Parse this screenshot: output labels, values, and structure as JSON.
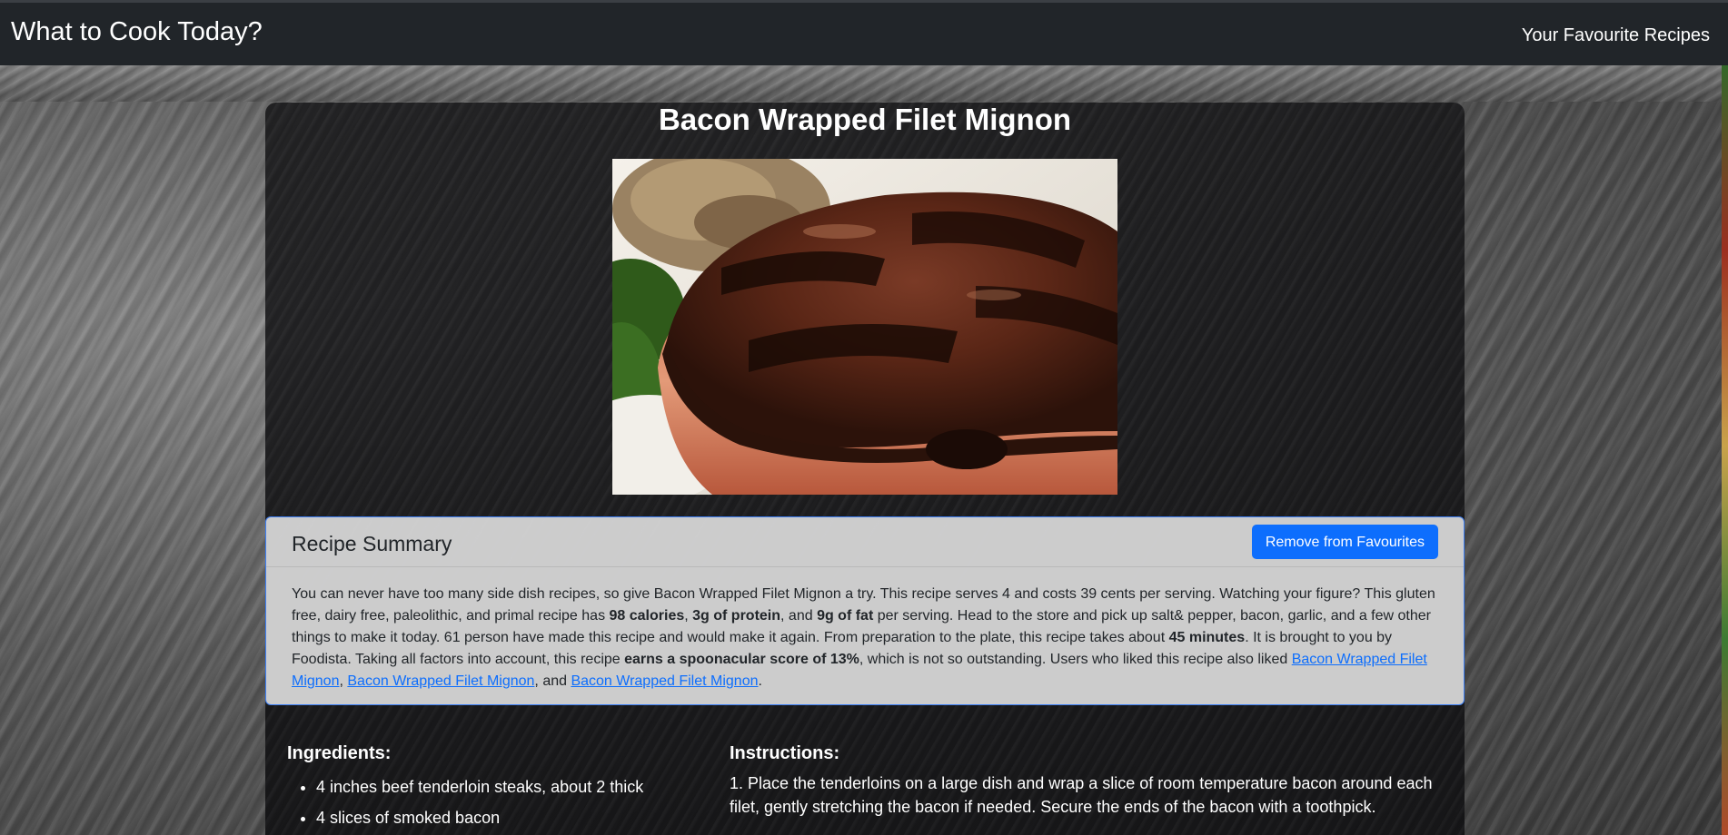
{
  "navbar": {
    "brand": "What to Cook Today?",
    "favourites_link": "Your Favourite Recipes"
  },
  "recipe": {
    "title": "Bacon Wrapped Filet Mignon",
    "image_alt": "Bacon Wrapped Filet Mignon"
  },
  "summary": {
    "heading": "Recipe Summary",
    "remove_button": "Remove from Favourites",
    "parts": {
      "t1": "You can never have too many side dish recipes, so give Bacon Wrapped Filet Mignon a try. This recipe serves 4 and costs 39 cents per serving. Watching your figure? This gluten free, dairy free, paleolithic, and primal recipe has ",
      "b1": "98 calories",
      "t2": ", ",
      "b2": "3g of protein",
      "t3": ", and ",
      "b3": "9g of fat",
      "t4": " per serving. Head to the store and pick up salt& pepper, bacon, garlic, and a few other things to make it today. 61 person have made this recipe and would make it again. From preparation to the plate, this recipe takes about ",
      "b4": "45 minutes",
      "t5": ". It is brought to you by Foodista. Taking all factors into account, this recipe ",
      "b5": "earns a spoonacular score of 13%",
      "t6": ", which is not so outstanding. Users who liked this recipe also liked ",
      "link1": "Bacon Wrapped Filet Mignon",
      "t7": ", ",
      "link2": "Bacon Wrapped Filet Mignon",
      "t8": ", and ",
      "link3": "Bacon Wrapped Filet Mignon",
      "t9": "."
    }
  },
  "ingredients": {
    "heading": "Ingredients:",
    "items": [
      "4 inches beef tenderloin steaks, about 2 thick",
      "4 slices of smoked bacon"
    ]
  },
  "instructions": {
    "heading": "Instructions:",
    "text": "1. Place the tenderloins on a large dish and wrap a slice of room temperature bacon around each filet, gently stretching the bacon if needed. Secure the ends of the bacon with a toothpick."
  },
  "colors": {
    "navbar": "#212529",
    "primary": "#0d6efd",
    "card_border": "#3d7ff5"
  }
}
